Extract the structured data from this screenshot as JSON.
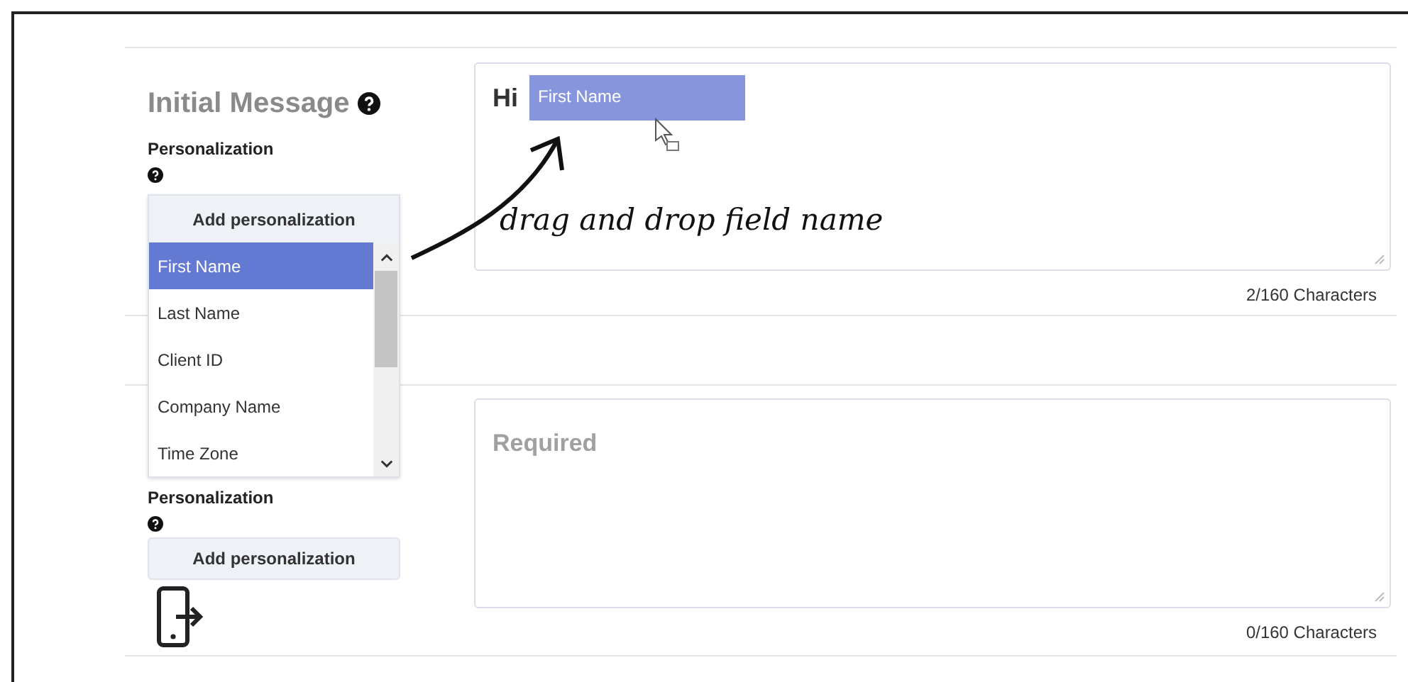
{
  "sections": [
    {
      "title": "Initial Message",
      "personalization_label": "Personalization",
      "message_prefix": "Hi",
      "field_token": "First Name",
      "counter": "2/160 Characters"
    },
    {
      "personalization_label": "Personalization",
      "button": "Add personalization",
      "placeholder": "Required",
      "counter": "0/160 Characters"
    }
  ],
  "dropdown": {
    "button": "Add personalization",
    "items": [
      {
        "label": "First Name",
        "selected": true
      },
      {
        "label": "Last Name",
        "selected": false
      },
      {
        "label": "Client ID",
        "selected": false
      },
      {
        "label": "Company Name",
        "selected": false
      },
      {
        "label": "Time Zone",
        "selected": false
      }
    ]
  },
  "annotation": "drag and drop field name"
}
